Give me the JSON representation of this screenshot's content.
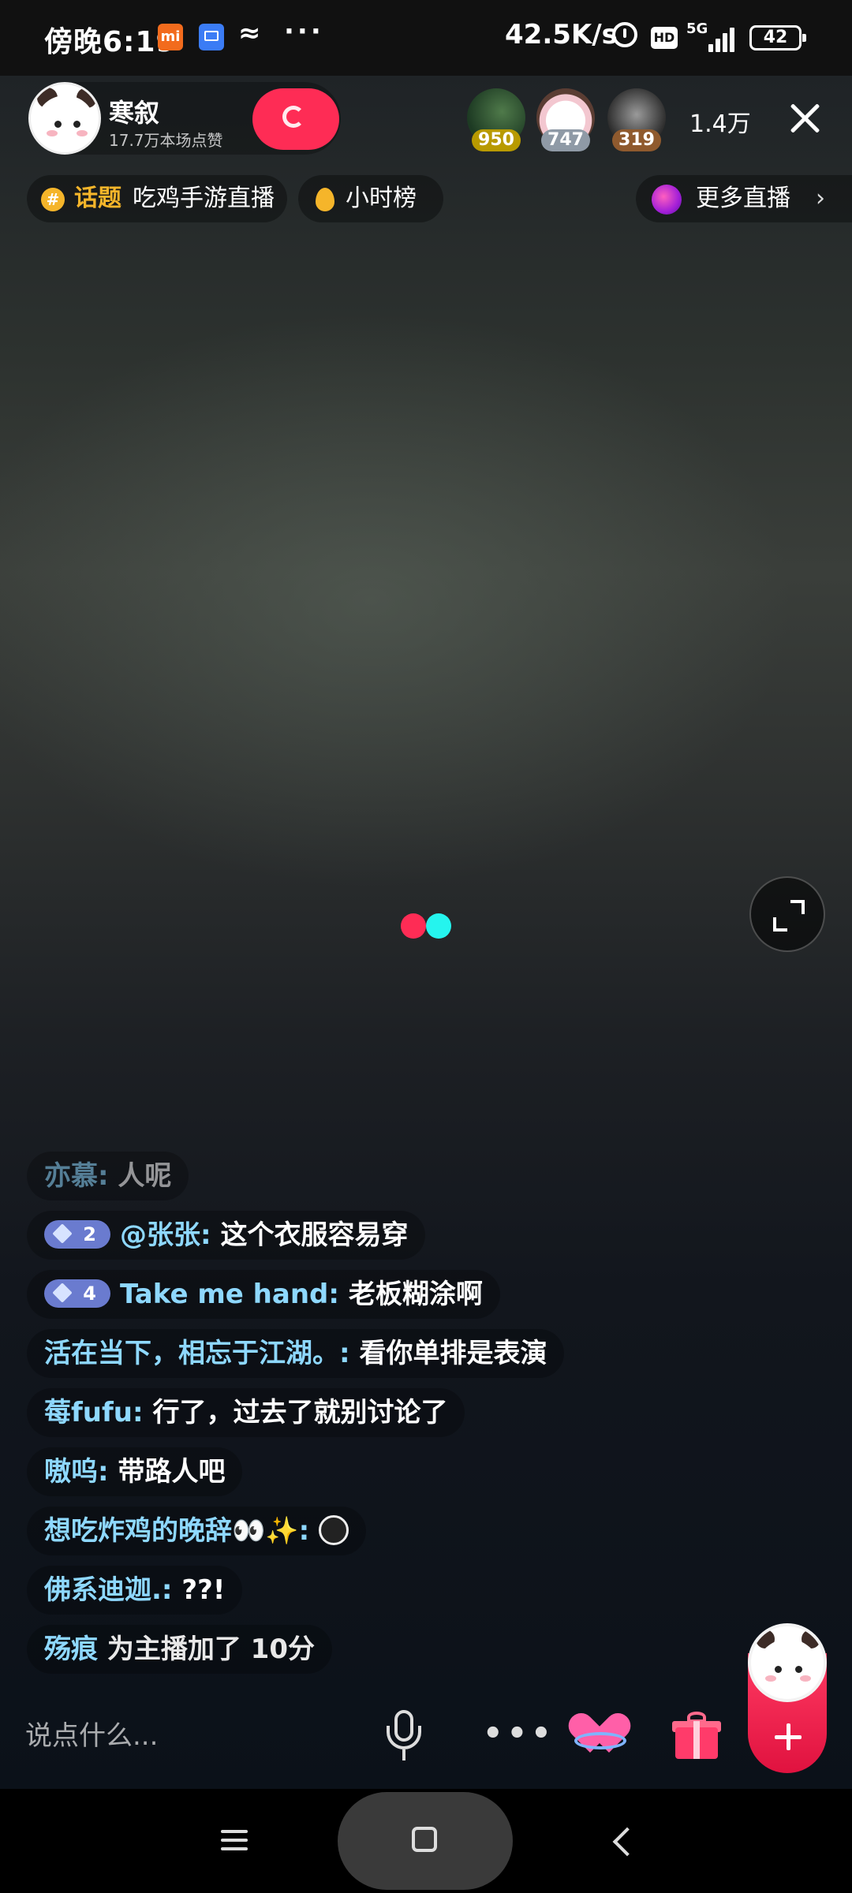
{
  "status_bar": {
    "time": "傍晚6:19",
    "mi_badge": "mi",
    "net_speed": "42.5K/s",
    "hd_badge": "HD",
    "network_type": "5G",
    "battery": "42",
    "icons": [
      "mi-app-icon",
      "message-icon",
      "connector-icon",
      "more-notifications-icon",
      "alarm-icon",
      "hd-icon",
      "signal-icon",
      "battery-icon"
    ]
  },
  "host": {
    "name": "寒叙",
    "likes": "17.7万本场点赞"
  },
  "viewers": {
    "top": [
      {
        "score": "950",
        "badge_color": "#c9a400"
      },
      {
        "score": "747",
        "badge_color": "#9aa5b1"
      },
      {
        "score": "319",
        "badge_color": "#a0693a"
      }
    ],
    "count": "1.4万"
  },
  "chips": {
    "topic_keyword": "话题",
    "topic_name": "吃鸡手游直播",
    "hour_rank": "小时榜",
    "more_live": "更多直播",
    "more_chevron": "›"
  },
  "chat": [
    {
      "user": "亦慕",
      "sep": ":",
      "text": "人呢",
      "faded": true
    },
    {
      "level": "2",
      "user": "@张张",
      "sep": ":",
      "text": "这个衣服容易穿"
    },
    {
      "level": "4",
      "user": "Take me hand",
      "sep": ":",
      "text": "老板糊涂啊"
    },
    {
      "user": "活在当下，相忘于江湖。",
      "sep": ":",
      "text": "看你单排是表演"
    },
    {
      "user": "莓fufu",
      "sep": ":",
      "text": "行了，过去了就别讨论了"
    },
    {
      "user": "嗷呜",
      "sep": ":",
      "text": "带路人吧"
    },
    {
      "user": "想吃炸鸡的晚辞👀✨",
      "sep": ":",
      "text": ""
    },
    {
      "user": "佛系迪迦.",
      "sep": ":",
      "text": "??!"
    },
    {
      "user": "殇痕",
      "sep": "",
      "text": " 为主播加了 10分"
    }
  ],
  "bottom_bar": {
    "input_placeholder": "说点什么..."
  },
  "colors": {
    "brand_red": "#fe2c55",
    "brand_cyan": "#25f4ee",
    "username_blue": "#8ed8ff",
    "topic_gold": "#f5b52a"
  }
}
